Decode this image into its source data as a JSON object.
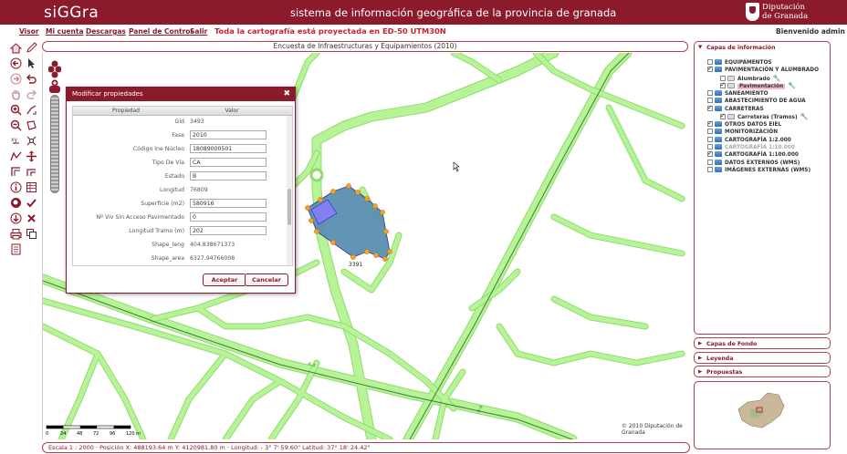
{
  "app": {
    "logo": "siGGra",
    "title": "sistema de información geográfica de la provincia de granada",
    "org_line1": "Diputación",
    "org_line2": "de Granada"
  },
  "menu": {
    "items": [
      "Visor",
      "Mi cuenta",
      "Descargas",
      "Panel de Control",
      "Salir"
    ],
    "notice": "Toda la cartografía está proyectada en ED-50 UTM30N",
    "welcome": "Bienvenido admin"
  },
  "map": {
    "title": "Encuesta de Infraestructuras y Equipamientos (2010)",
    "status": "Escala 1 : 2000 · Posición X: 488193.64 m Y: 4120981.80 m · Longitud: - 3° 7' 59.60\" Latitud: 37° 18' 24.42\"",
    "copyright": "© 2010 Diputación de Granada",
    "scale_labels": [
      "0",
      "24",
      "48",
      "72",
      "96",
      "120 m"
    ],
    "road_label": "A-4",
    "road_label_2": "A-4",
    "parcel_label": "3391",
    "colors": {
      "roads": "#b7f397",
      "road_border": "#8fdc6c",
      "parcel_fill": "#5a8fb0",
      "parcel_vertex": "#f0a030",
      "blue_shape": "#8080f0"
    }
  },
  "dialog": {
    "title": "Modificar propiedades",
    "col_property": "Propiedad",
    "col_value": "Valor",
    "rows": [
      {
        "name": "Gid",
        "value": "3493",
        "editable": false
      },
      {
        "name": "Fase",
        "value": "2010",
        "editable": true
      },
      {
        "name": "Código Ine Núcleo",
        "value": "18089000501",
        "editable": true
      },
      {
        "name": "Tipo De Vía",
        "value": "CA",
        "editable": true
      },
      {
        "name": "Estado",
        "value": "B",
        "editable": true
      },
      {
        "name": "Longitud",
        "value": "76809",
        "editable": false
      },
      {
        "name": "Superficie (m2)",
        "value": "580916",
        "editable": true
      },
      {
        "name": "Nº Viv Sin Acceso Pavimentado",
        "value": "0",
        "editable": true
      },
      {
        "name": "Longitud Tramo (m)",
        "value": "202",
        "editable": true
      },
      {
        "name": "Shape_leng",
        "value": "404.838671373",
        "editable": false
      },
      {
        "name": "Shape_area",
        "value": "6327.94766008",
        "editable": false
      }
    ],
    "accept_label": "Aceptar",
    "cancel_label": "Cancelar"
  },
  "panels": {
    "layers_title": "Capas de información",
    "layers": [
      {
        "label": "EQUIPAMENTOS",
        "checked": false,
        "indent": 0,
        "grey": false,
        "icon": "db"
      },
      {
        "label": "PAVIMENTACIÓN Y ALUMBRADO",
        "checked": true,
        "indent": 0,
        "grey": false,
        "icon": "db"
      },
      {
        "label": "Alumbrado",
        "checked": false,
        "indent": 1,
        "grey": false,
        "icon": "img",
        "wrench": true
      },
      {
        "label": "Pavimentación",
        "checked": true,
        "indent": 1,
        "grey": false,
        "icon": "img",
        "highlight": true,
        "wrench": true
      },
      {
        "label": "SANEAMIENTO",
        "checked": false,
        "indent": 0,
        "grey": false,
        "icon": "db"
      },
      {
        "label": "ABASTECIMIENTO DE AGUA",
        "checked": false,
        "indent": 0,
        "grey": false,
        "icon": "db"
      },
      {
        "label": "CARRETERAS",
        "checked": true,
        "indent": 0,
        "grey": false,
        "icon": "db"
      },
      {
        "label": "Carreteras (Tramos)",
        "checked": true,
        "indent": 1,
        "grey": false,
        "icon": "img",
        "wrench": true
      },
      {
        "label": "OTROS DATOS EIEL",
        "checked": true,
        "indent": 0,
        "grey": false,
        "icon": "db"
      },
      {
        "label": "MONITORIZACIÓN",
        "checked": false,
        "indent": 0,
        "grey": false,
        "icon": "db"
      },
      {
        "label": "CARTOGRAFÍA 1:2.000",
        "checked": false,
        "indent": 0,
        "grey": false,
        "icon": "db"
      },
      {
        "label": "CARTOGRAFÍA 1:10.000",
        "checked": false,
        "indent": 0,
        "grey": true,
        "icon": "db"
      },
      {
        "label": "CARTOGRAFÍA 1:100.000",
        "checked": true,
        "indent": 0,
        "grey": false,
        "icon": "db"
      },
      {
        "label": "DATOS EXTERNOS (WMS)",
        "checked": false,
        "indent": 0,
        "grey": false,
        "icon": "db"
      },
      {
        "label": "IMÁGENES EXTERNAS (WMS)",
        "checked": false,
        "indent": 0,
        "grey": false,
        "icon": "db"
      }
    ],
    "base_title": "Capas de Fondo",
    "legend_title": "Leyenda",
    "proposals_title": "Propuestas"
  }
}
